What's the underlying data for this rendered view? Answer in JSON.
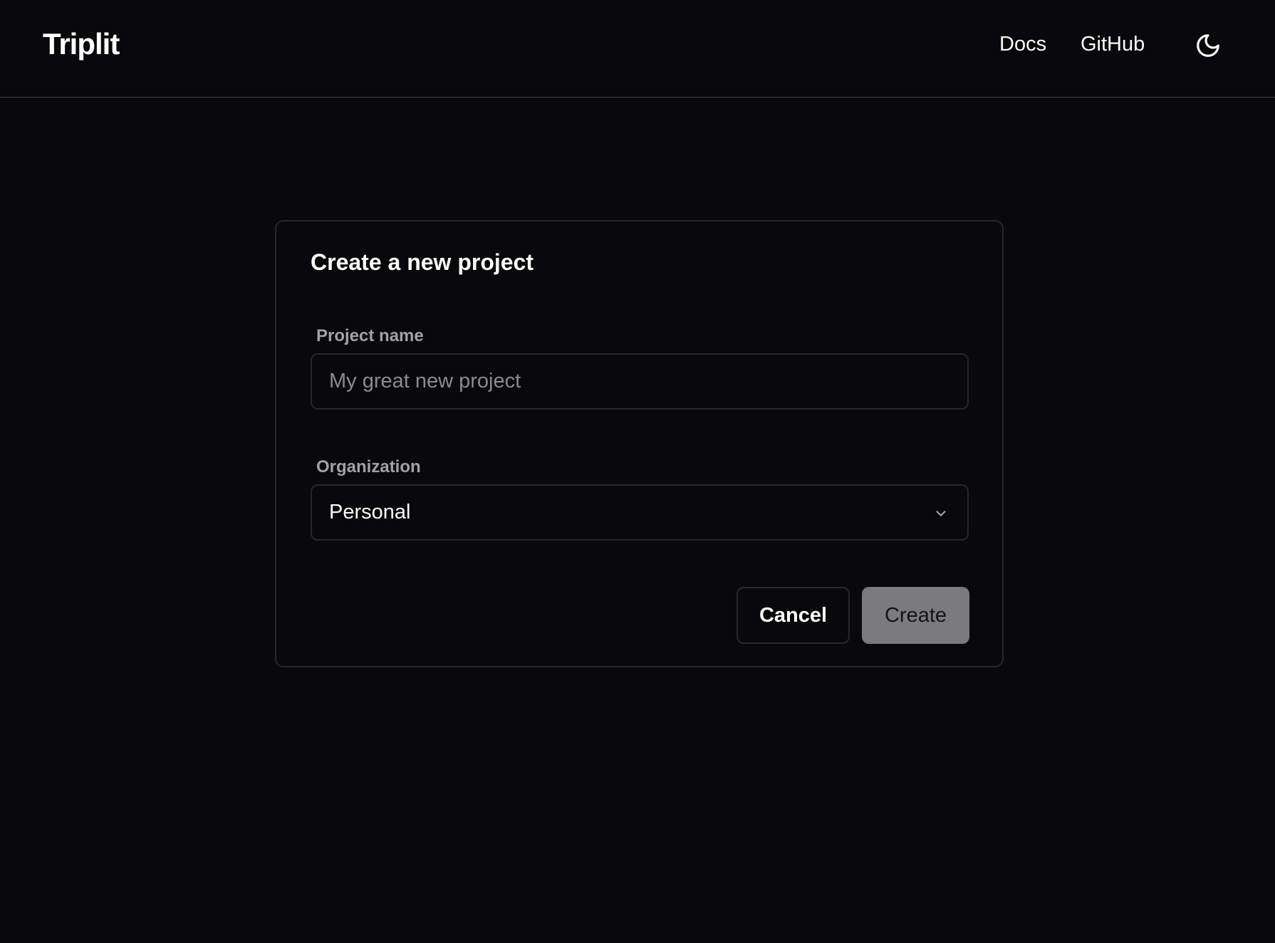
{
  "header": {
    "logo": "Triplit",
    "nav": {
      "docs_label": "Docs",
      "github_label": "GitHub"
    },
    "theme_toggle_icon": "moon-icon"
  },
  "dialog": {
    "title": "Create a new project",
    "project_name": {
      "label": "Project name",
      "placeholder": "My great new project",
      "value": ""
    },
    "organization": {
      "label": "Organization",
      "selected": "Personal",
      "icon": "chevron-down-icon"
    },
    "actions": {
      "cancel_label": "Cancel",
      "create_label": "Create"
    }
  },
  "colors": {
    "background": "#09090b",
    "border": "#27272a",
    "muted_text": "#a1a1aa",
    "create_button_disabled": "#7b7b7f"
  }
}
